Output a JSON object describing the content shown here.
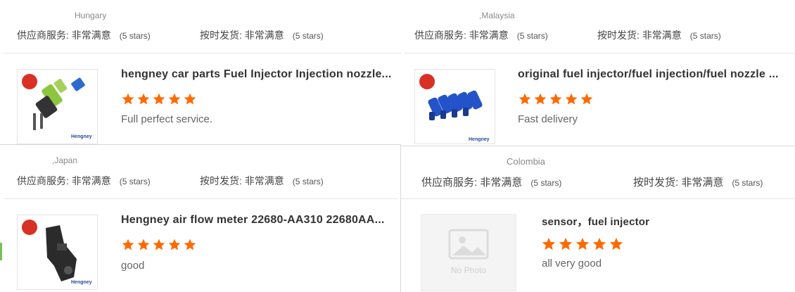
{
  "cards": [
    {
      "country": "Hungary",
      "supplier_label": "供应商服务: 非常满意",
      "supplier_value": "(5 stars)",
      "delivery_label": "按时发货: 非常满意",
      "delivery_value": "(5 stars)",
      "title": "hengney car parts Fuel Injector Injection nozzle...",
      "rating": 5,
      "review": "Full perfect service.",
      "image": "fuel-injector-green",
      "brand": "Hengney"
    },
    {
      "country": ",Malaysia",
      "supplier_label": "供应商服务: 非常满意",
      "supplier_value": "(5 stars)",
      "delivery_label": "按时发货: 非常满意",
      "delivery_value": "(5 stars)",
      "title": "original fuel injector/fuel injection/fuel nozzle ...",
      "rating": 5,
      "review": "Fast delivery",
      "image": "fuel-injector-blue-set",
      "brand": "Hengney"
    },
    {
      "country": ",Japan",
      "supplier_label": "供应商服务: 非常满意",
      "supplier_value": "(5 stars)",
      "delivery_label": "按时发货: 非常满意",
      "delivery_value": "(5 stars)",
      "title": "Hengney air flow meter 22680-AA310 22680AA...",
      "rating": 5,
      "review": "good",
      "image": "air-flow-meter",
      "brand": "Hengney"
    },
    {
      "country": "Colombia",
      "supplier_label": "供应商服务: 非常满意",
      "supplier_value": "(5 stars)",
      "delivery_label": "按时发货: 非常满意",
      "delivery_value": "(5 stars)",
      "title": "sensor，fuel injector",
      "rating": 5,
      "review": "all very good",
      "image": "no-photo",
      "no_photo_text": "No Photo"
    }
  ],
  "colors": {
    "star": "#ff6a00",
    "logo_red": "#d93025",
    "injector_blue": "#2453c9",
    "injector_green": "#8cc63f"
  }
}
